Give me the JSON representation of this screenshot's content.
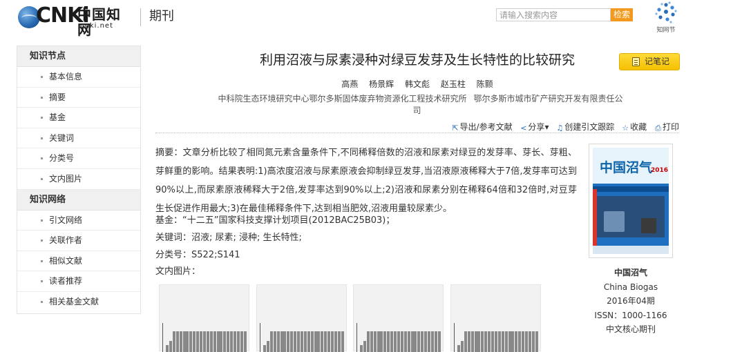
{
  "header": {
    "logo_word": "CNKi",
    "logo_cn": "中国知网",
    "logo_url": "cnki.net",
    "section": "期刊",
    "search_placeholder": "请输入搜索内容",
    "search_button": "检索",
    "zhiwang_label": "知网节"
  },
  "sidebar": {
    "groups": [
      {
        "title": "知识节点",
        "items": [
          "基本信息",
          "摘要",
          "基金",
          "关键词",
          "分类号",
          "文内图片"
        ]
      },
      {
        "title": "知识网络",
        "items": [
          "引文网络",
          "关联作者",
          "相似文献",
          "读者推荐",
          "相关基金文献"
        ]
      }
    ]
  },
  "article": {
    "title": "利用沼液与尿素浸种对绿豆发芽及生长特性的比较研究",
    "note_button": "记笔记",
    "authors": [
      "高燕",
      "杨景辉",
      "韩文彪",
      "赵玉柱",
      "陈颢"
    ],
    "orgs": [
      "中科院生态环境研究中心鄂尔多斯固体废弃物资源化工程技术研究所",
      "鄂尔多斯市城市矿产研究开发有限责任公司"
    ],
    "tools": {
      "export": "导出/参考文献",
      "share": "分享",
      "cite_track": "创建引文跟踪",
      "favorite": "收藏",
      "print": "打印"
    },
    "abstract_label": "摘要：",
    "abstract": "文章分析比较了相同氮元素含量条件下,不同稀释倍数的沼液和尿素对绿豆的发芽率、芽长、芽粗、芽鲜重的影响。结果表明:1)高浓度沼液与尿素原液会抑制绿豆发芽,当沼液原液稀释大于7倍,发芽率可达到90%以上,而尿素原液稀释大于2倍,发芽率达到90%以上;2)沼液和尿素分别在稀释64倍和32倍时,对豆芽生长促进作用最大;3)在最佳稀释条件下,达到相当肥效,沼液用量较尿素少。",
    "fund_label": "基金：",
    "fund": "“十二五”国家科技支撑计划项目(2012BAC25B03)；",
    "keywords_label": "关键词：",
    "keywords": "沼液; 尿素; 浸种; 生长特性;",
    "class_label": "分类号：",
    "class": "S522;S141",
    "figures_label": "文内图片："
  },
  "journal": {
    "cover_title": "中国沼气",
    "cover_year": "2016",
    "name_cn": "中国沼气",
    "name_en": "China Biogas",
    "issue": "2016年04期",
    "issn": "ISSN：1000-1166",
    "core": "中文核心期刊"
  }
}
